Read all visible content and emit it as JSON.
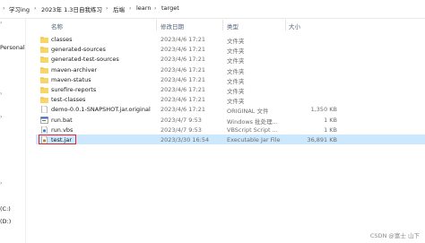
{
  "breadcrumb": {
    "items": [
      "学习ing",
      "2023年 1.3日自我练习",
      "后端",
      "learn",
      "target"
    ]
  },
  "nav": {
    "items": [
      "Personal",
      "(C:)",
      "(D:)"
    ]
  },
  "columns": {
    "name": "名称",
    "date": "修改日期",
    "type": "类型",
    "size": "大小"
  },
  "files": [
    {
      "name": "classes",
      "date": "2023/4/6 17:21",
      "type": "文件夹",
      "size": "",
      "icon": "folder-icon"
    },
    {
      "name": "generated-sources",
      "date": "2023/4/6 17:21",
      "type": "文件夹",
      "size": "",
      "icon": "folder-icon"
    },
    {
      "name": "generated-test-sources",
      "date": "2023/4/6 17:21",
      "type": "文件夹",
      "size": "",
      "icon": "folder-icon"
    },
    {
      "name": "maven-archiver",
      "date": "2023/4/6 17:21",
      "type": "文件夹",
      "size": "",
      "icon": "folder-icon"
    },
    {
      "name": "maven-status",
      "date": "2023/4/6 17:21",
      "type": "文件夹",
      "size": "",
      "icon": "folder-icon"
    },
    {
      "name": "surefire-reports",
      "date": "2023/4/6 17:21",
      "type": "文件夹",
      "size": "",
      "icon": "folder-icon"
    },
    {
      "name": "test-classes",
      "date": "2023/4/6 17:21",
      "type": "文件夹",
      "size": "",
      "icon": "folder-icon"
    },
    {
      "name": "demo-0.0.1-SNAPSHOT.jar.original",
      "date": "2023/4/6 17:21",
      "type": "ORIGINAL 文件",
      "size": "1,350 KB",
      "icon": "file-icon"
    },
    {
      "name": "run.bat",
      "date": "2023/4/7 9:53",
      "type": "Windows 批处理...",
      "size": "1 KB",
      "icon": "bat-file-icon"
    },
    {
      "name": "run.vbs",
      "date": "2023/4/7 9:53",
      "type": "VBScript Script ...",
      "size": "1 KB",
      "icon": "vbs-file-icon"
    },
    {
      "name": "test.jar",
      "date": "2023/3/30 16:54",
      "type": "Executable Jar File",
      "size": "36,891 KB",
      "icon": "jar-file-icon"
    }
  ],
  "selected_index": 10,
  "highlight_color": "#e0262b",
  "watermark": "CSDN @富士 山下"
}
